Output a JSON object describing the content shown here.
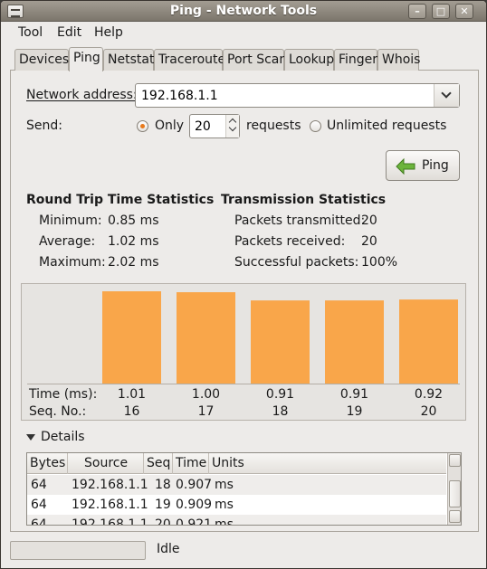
{
  "window": {
    "title": "Ping - Network Tools"
  },
  "menubar": [
    "Tool",
    "Edit",
    "Help"
  ],
  "tabs": [
    "Devices",
    "Ping",
    "Netstat",
    "Traceroute",
    "Port Scan",
    "Lookup",
    "Finger",
    "Whois"
  ],
  "active_tab": "Ping",
  "form": {
    "address_label": "Network address:",
    "address_value": "192.168.1.1",
    "send_label": "Send:",
    "only_label": "Only",
    "count_value": "20",
    "requests_label": "requests",
    "unlimited_label": "Unlimited requests",
    "selected_mode": "Only",
    "ping_button": "Ping"
  },
  "rtt": {
    "title": "Round Trip Time Statistics",
    "rows": [
      {
        "label": "Minimum:",
        "value": "0.85 ms"
      },
      {
        "label": "Average:",
        "value": "1.02 ms"
      },
      {
        "label": "Maximum:",
        "value": "2.02 ms"
      }
    ]
  },
  "tx": {
    "title": "Transmission Statistics",
    "rows": [
      {
        "label": "Packets transmitted:",
        "value": "20"
      },
      {
        "label": "Packets received:",
        "value": "20"
      },
      {
        "label": "Successful packets:",
        "value": "100%"
      }
    ]
  },
  "chart_data": {
    "type": "bar",
    "categories": [
      "16",
      "17",
      "18",
      "19",
      "20"
    ],
    "values": [
      1.01,
      1.0,
      0.91,
      0.91,
      0.92
    ],
    "value_labels": [
      "1.01",
      "1.00",
      "0.91",
      "0.91",
      "0.92"
    ],
    "row_labels": [
      "Time (ms):",
      "Seq. No.:"
    ],
    "ylim": [
      0,
      1.03
    ],
    "bar_color": "#f9a64a"
  },
  "details": {
    "label": "Details",
    "columns": [
      "Bytes",
      "Source",
      "Seq",
      "Time",
      "Units"
    ],
    "rows": [
      [
        "64",
        "192.168.1.1",
        "18",
        "0.907",
        "ms"
      ],
      [
        "64",
        "192.168.1.1",
        "19",
        "0.909",
        "ms"
      ],
      [
        "64",
        "192.168.1.1",
        "20",
        "0.921",
        "ms"
      ]
    ]
  },
  "status": {
    "text": "Idle"
  }
}
